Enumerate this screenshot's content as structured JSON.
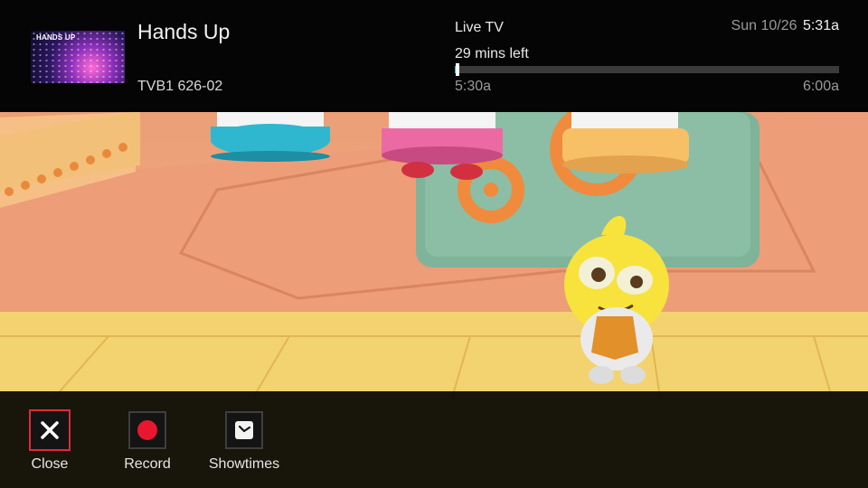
{
  "program": {
    "title": "Hands Up",
    "channel": "TVB1 626-02",
    "thumbnail_text": "HANDS UP"
  },
  "playback": {
    "mode": "Live TV",
    "time_left": "29 mins left",
    "start_time": "5:30a",
    "end_time": "6:00a",
    "progress_fraction": 0.008
  },
  "clock": {
    "date": "Sun 10/26",
    "time": "5:31a"
  },
  "actions": [
    {
      "label": "Close",
      "icon": "close-icon",
      "selected": true
    },
    {
      "label": "Record",
      "icon": "record-icon",
      "selected": false
    },
    {
      "label": "Showtimes",
      "icon": "clock-icon",
      "selected": false
    }
  ],
  "colors": {
    "accent": "#19b9c9",
    "selection": "#e02a3a",
    "record": "#e8162f"
  }
}
